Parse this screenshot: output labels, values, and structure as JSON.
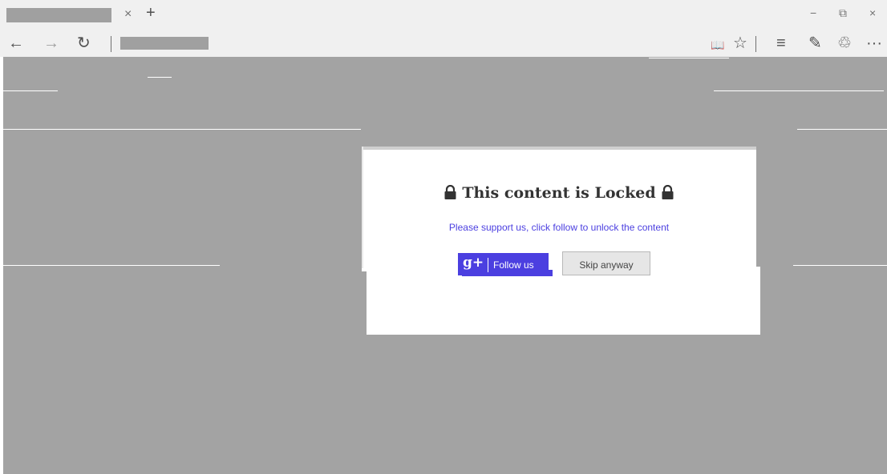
{
  "browser": {
    "tab": {
      "close_glyph": "×",
      "new_tab_glyph": "+"
    },
    "window_controls": {
      "minimize": "−",
      "restore": "⧉",
      "close": "×"
    },
    "nav": {
      "back": "←",
      "forward": "→",
      "refresh": "↻"
    },
    "toolbar": {
      "reading_view": "📖",
      "favorite": "☆",
      "hub": "≡",
      "web_note": "✎",
      "share": "♲",
      "more": "···"
    }
  },
  "dialog": {
    "title": "This content is Locked",
    "subtitle": "Please support us, click follow to unlock the content",
    "follow_button": {
      "icon_text": "g+",
      "label": "Follow us"
    },
    "skip_button": {
      "label": "Skip anyway"
    }
  },
  "colors": {
    "accent": "#4b3fe0",
    "overlay": "#a3a3a3",
    "chrome": "#f0f0f0"
  }
}
